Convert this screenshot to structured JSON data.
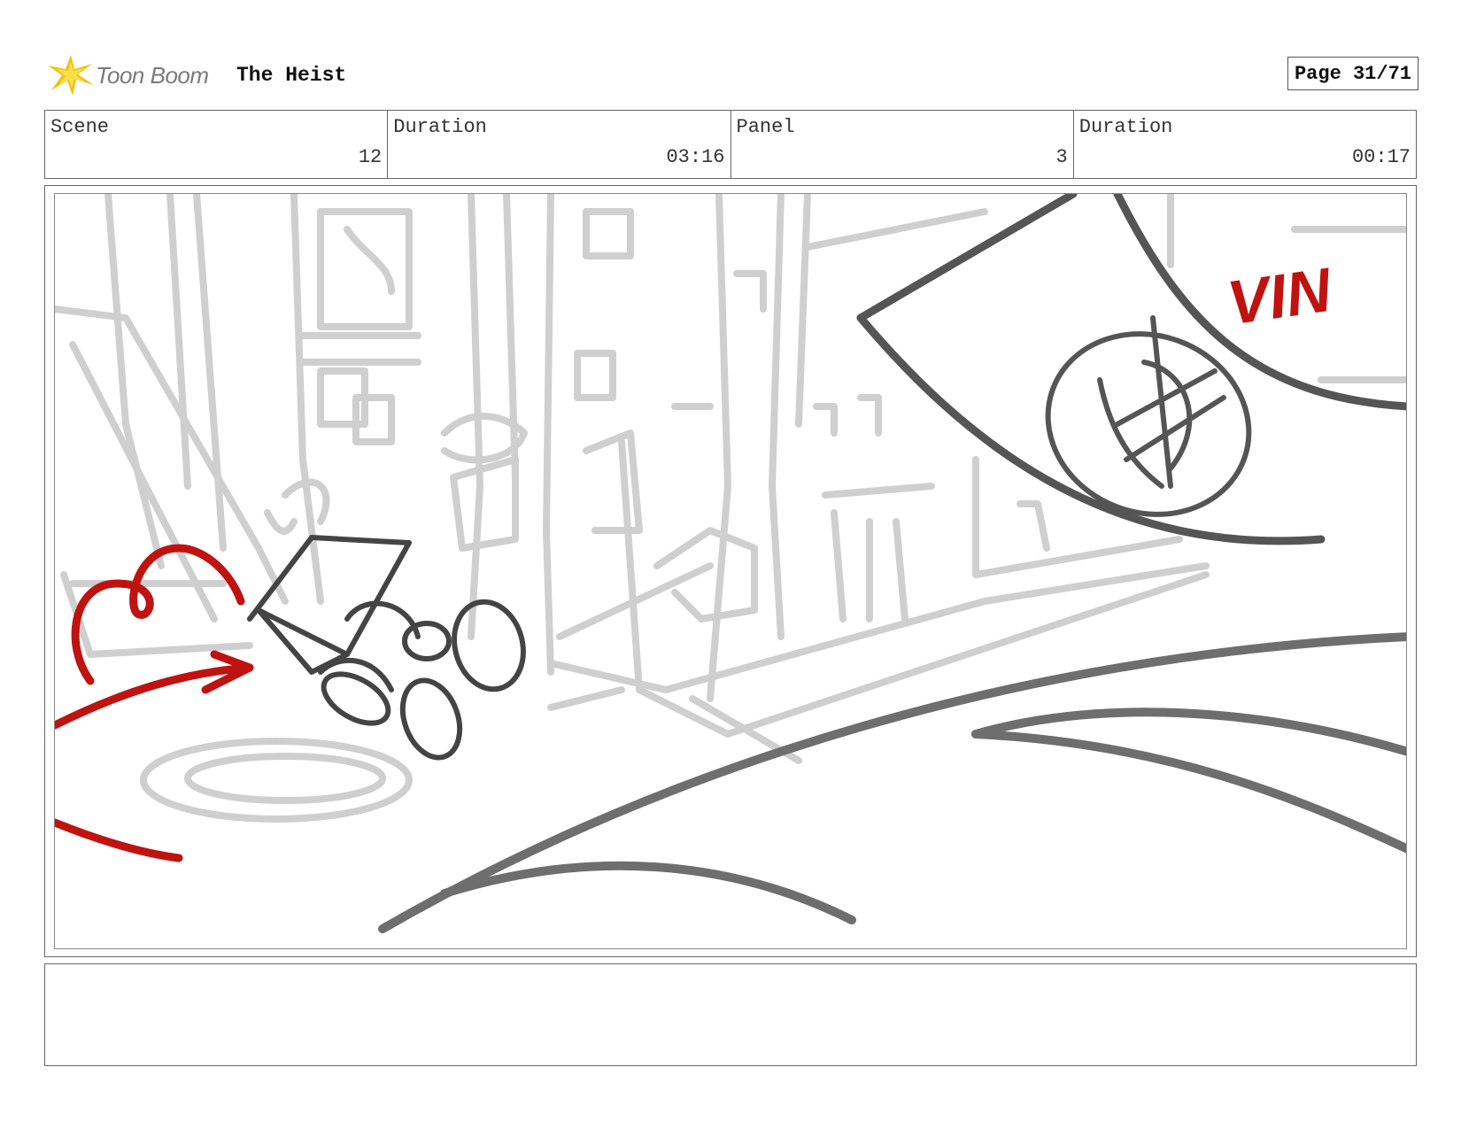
{
  "header": {
    "logo_text": "Toon Boom",
    "title": "The Heist",
    "page_label": "Page 31/71"
  },
  "info": {
    "scene_label": "Scene",
    "scene_value": "12",
    "scene_duration_label": "Duration",
    "scene_duration_value": "03:16",
    "panel_label": "Panel",
    "panel_value": "3",
    "panel_duration_label": "Duration",
    "panel_duration_value": "00:17"
  },
  "sketch": {
    "annotation_text": "VIN",
    "accent_color": "#c0120f",
    "line_color": "#555555",
    "background_color": "#cfcfcf"
  },
  "notes": {
    "text": ""
  }
}
